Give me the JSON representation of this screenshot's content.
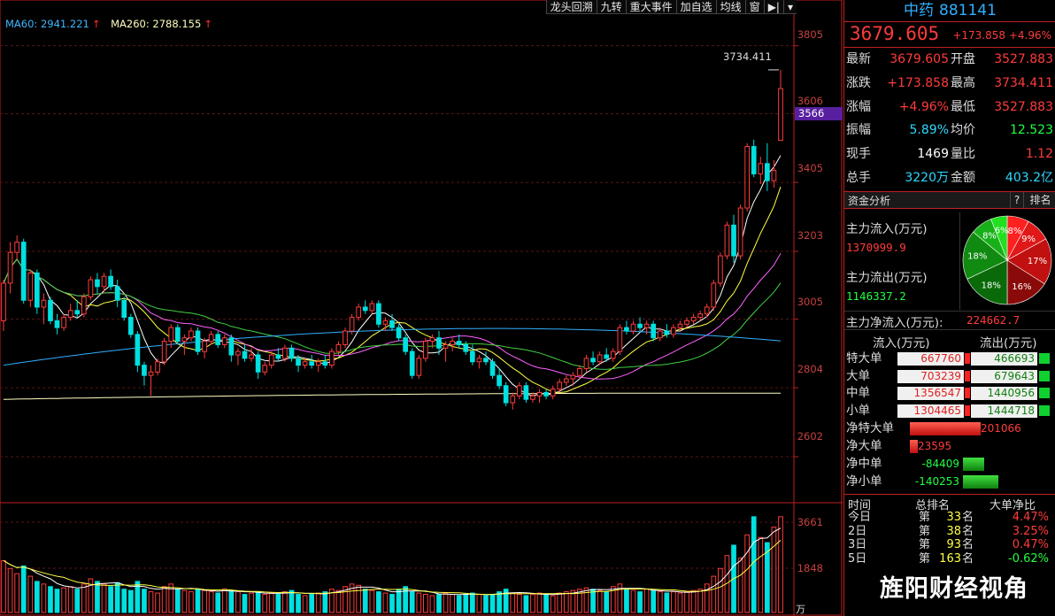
{
  "toolbar": {
    "buttons": [
      "龙头回溯",
      "九转",
      "重大事件",
      "加自选",
      "均线",
      "窗"
    ],
    "arrow_glyph": "▶|"
  },
  "ma_legend": {
    "ma60": "MA60: 2941.221",
    "ma260": "MA260: 2788.155",
    "up_arrow": "↑"
  },
  "price_axis": [
    "3805",
    "3606",
    "3405",
    "3203",
    "3005",
    "2804",
    "2602"
  ],
  "current_price_tag": "3566",
  "high_label": "3734.411",
  "volume_axis": [
    "3661",
    "1848"
  ],
  "volume_unit": "万",
  "colors": {
    "up": "#ff3b3b",
    "down": "#00e0e0",
    "ma5": "#ffffff",
    "ma10": "#ffff40",
    "ma20": "#ff60ff",
    "ma30": "#40d040",
    "ma60": "#30b0ff",
    "ma260": "#ffffc0",
    "panel_border": "#c02020"
  },
  "chart_data": {
    "type": "candlestick",
    "ylim": [
      2470,
      3900
    ],
    "candles": [
      [
        3000,
        3120,
        2970,
        3110
      ],
      [
        3110,
        3230,
        3080,
        3200
      ],
      [
        3200,
        3250,
        3180,
        3230
      ],
      [
        3230,
        3240,
        3050,
        3060
      ],
      [
        3060,
        3150,
        3040,
        3140
      ],
      [
        3140,
        3150,
        3020,
        3040
      ],
      [
        3040,
        3080,
        2990,
        3060
      ],
      [
        3060,
        3070,
        2990,
        3000
      ],
      [
        3000,
        3020,
        2960,
        2980
      ],
      [
        2980,
        3020,
        2970,
        3010
      ],
      [
        3010,
        3050,
        3000,
        3030
      ],
      [
        3030,
        3060,
        3010,
        3020
      ],
      [
        3020,
        3080,
        3010,
        3070
      ],
      [
        3070,
        3130,
        3060,
        3120
      ],
      [
        3120,
        3140,
        3080,
        3100
      ],
      [
        3100,
        3140,
        3080,
        3130
      ],
      [
        3130,
        3150,
        3090,
        3100
      ],
      [
        3100,
        3120,
        3040,
        3060
      ],
      [
        3060,
        3070,
        3000,
        3010
      ],
      [
        3010,
        3020,
        2950,
        2960
      ],
      [
        2960,
        2970,
        2850,
        2870
      ],
      [
        2870,
        2880,
        2810,
        2840
      ],
      [
        2840,
        2870,
        2780,
        2850
      ],
      [
        2850,
        2890,
        2840,
        2880
      ],
      [
        2880,
        2950,
        2870,
        2940
      ],
      [
        2940,
        2990,
        2920,
        2980
      ],
      [
        2980,
        2990,
        2930,
        2940
      ],
      [
        2940,
        2960,
        2900,
        2950
      ],
      [
        2950,
        2980,
        2940,
        2970
      ],
      [
        2970,
        2980,
        2900,
        2910
      ],
      [
        2910,
        2950,
        2890,
        2940
      ],
      [
        2940,
        2970,
        2930,
        2960
      ],
      [
        2960,
        2970,
        2920,
        2930
      ],
      [
        2930,
        2960,
        2920,
        2950
      ],
      [
        2950,
        2960,
        2880,
        2900
      ],
      [
        2900,
        2920,
        2870,
        2910
      ],
      [
        2910,
        2930,
        2880,
        2890
      ],
      [
        2890,
        2920,
        2880,
        2900
      ],
      [
        2900,
        2910,
        2830,
        2850
      ],
      [
        2850,
        2880,
        2840,
        2870
      ],
      [
        2870,
        2910,
        2860,
        2900
      ],
      [
        2900,
        2920,
        2880,
        2890
      ],
      [
        2890,
        2930,
        2880,
        2920
      ],
      [
        2920,
        2930,
        2880,
        2890
      ],
      [
        2890,
        2900,
        2850,
        2870
      ],
      [
        2870,
        2890,
        2860,
        2880
      ],
      [
        2880,
        2900,
        2860,
        2870
      ],
      [
        2870,
        2890,
        2850,
        2880
      ],
      [
        2880,
        2900,
        2860,
        2870
      ],
      [
        2870,
        2920,
        2860,
        2910
      ],
      [
        2910,
        2940,
        2900,
        2930
      ],
      [
        2930,
        2980,
        2920,
        2970
      ],
      [
        2970,
        3020,
        2960,
        3010
      ],
      [
        3010,
        3050,
        3000,
        3040
      ],
      [
        3040,
        3060,
        3020,
        3030
      ],
      [
        3030,
        3060,
        3020,
        3050
      ],
      [
        3050,
        3060,
        2980,
        2990
      ],
      [
        2990,
        3010,
        2970,
        3000
      ],
      [
        3000,
        3020,
        2970,
        2980
      ],
      [
        2980,
        2990,
        2940,
        2950
      ],
      [
        2950,
        2960,
        2900,
        2910
      ],
      [
        2910,
        2920,
        2830,
        2840
      ],
      [
        2840,
        2900,
        2830,
        2890
      ],
      [
        2890,
        2950,
        2880,
        2940
      ],
      [
        2940,
        2960,
        2920,
        2950
      ],
      [
        2950,
        2970,
        2900,
        2920
      ],
      [
        2920,
        2940,
        2880,
        2930
      ],
      [
        2930,
        2950,
        2910,
        2940
      ],
      [
        2940,
        2960,
        2920,
        2930
      ],
      [
        2930,
        2940,
        2900,
        2910
      ],
      [
        2910,
        2930,
        2870,
        2880
      ],
      [
        2880,
        2900,
        2860,
        2890
      ],
      [
        2890,
        2910,
        2870,
        2880
      ],
      [
        2880,
        2890,
        2830,
        2840
      ],
      [
        2840,
        2860,
        2800,
        2810
      ],
      [
        2810,
        2820,
        2750,
        2760
      ],
      [
        2760,
        2790,
        2740,
        2780
      ],
      [
        2780,
        2820,
        2770,
        2810
      ],
      [
        2810,
        2820,
        2760,
        2770
      ],
      [
        2770,
        2790,
        2760,
        2780
      ],
      [
        2780,
        2800,
        2760,
        2790
      ],
      [
        2790,
        2800,
        2770,
        2780
      ],
      [
        2780,
        2810,
        2770,
        2800
      ],
      [
        2800,
        2830,
        2790,
        2820
      ],
      [
        2820,
        2840,
        2810,
        2830
      ],
      [
        2830,
        2850,
        2810,
        2840
      ],
      [
        2840,
        2870,
        2830,
        2860
      ],
      [
        2860,
        2900,
        2850,
        2890
      ],
      [
        2890,
        2910,
        2870,
        2880
      ],
      [
        2880,
        2910,
        2870,
        2900
      ],
      [
        2900,
        2920,
        2880,
        2890
      ],
      [
        2890,
        2920,
        2880,
        2910
      ],
      [
        2910,
        2990,
        2900,
        2980
      ],
      [
        2980,
        3000,
        2960,
        2970
      ],
      [
        2970,
        3000,
        2960,
        2990
      ],
      [
        2990,
        3010,
        2970,
        2980
      ],
      [
        2980,
        3000,
        2960,
        2990
      ],
      [
        2990,
        3000,
        2940,
        2950
      ],
      [
        2950,
        2980,
        2940,
        2970
      ],
      [
        2970,
        2990,
        2950,
        2960
      ],
      [
        2960,
        2990,
        2950,
        2980
      ],
      [
        2980,
        3000,
        2970,
        2990
      ],
      [
        2990,
        3010,
        2980,
        3000
      ],
      [
        3000,
        3020,
        2990,
        3010
      ],
      [
        3010,
        3030,
        3000,
        3020
      ],
      [
        3020,
        3050,
        3010,
        3040
      ],
      [
        3040,
        3120,
        3030,
        3110
      ],
      [
        3110,
        3200,
        3100,
        3190
      ],
      [
        3190,
        3290,
        3180,
        3280
      ],
      [
        3280,
        3310,
        3170,
        3190
      ],
      [
        3190,
        3340,
        3180,
        3330
      ],
      [
        3330,
        3520,
        3320,
        3510
      ],
      [
        3510,
        3530,
        3420,
        3430
      ],
      [
        3430,
        3480,
        3400,
        3460
      ],
      [
        3460,
        3520,
        3380,
        3410
      ],
      [
        3410,
        3470,
        3390,
        3440
      ],
      [
        3527.883,
        3734.411,
        3527.883,
        3679.605
      ]
    ],
    "volumes": [
      2000,
      1700,
      1500,
      1800,
      1400,
      1200,
      1100,
      1000,
      900,
      950,
      1000,
      900,
      1100,
      1300,
      1200,
      1100,
      1000,
      1150,
      900,
      850,
      1200,
      900,
      800,
      750,
      1000,
      1100,
      900,
      850,
      800,
      900,
      850,
      800,
      750,
      900,
      850,
      800,
      700,
      750,
      800,
      700,
      750,
      700,
      800,
      850,
      700,
      650,
      700,
      750,
      800,
      900,
      850,
      1000,
      1100,
      1050,
      900,
      850,
      800,
      750,
      700,
      900,
      1000,
      800,
      750,
      700,
      650,
      700,
      750,
      700,
      650,
      700,
      750,
      700,
      650,
      700,
      800,
      900,
      750,
      700,
      650,
      700,
      750,
      700,
      650,
      750,
      800,
      850,
      900,
      950,
      900,
      850,
      800,
      1000,
      1100,
      900,
      850,
      800,
      900,
      850,
      800,
      750,
      800,
      750,
      800,
      850,
      900,
      1100,
      1400,
      1700,
      2200,
      2600,
      2100,
      3000,
      3700,
      2900,
      2700,
      3300,
      3700
    ]
  },
  "panel": {
    "name": "中药",
    "code": "881141",
    "price": "3679.605",
    "change": "+173.858 +4.96%",
    "rows": [
      {
        "l1": "最新",
        "v1": "3679.605",
        "c1": "red",
        "l2": "开盘",
        "v2": "3527.883",
        "c2": "red"
      },
      {
        "l1": "涨跌",
        "v1": "+173.858",
        "c1": "red",
        "l2": "最高",
        "v2": "3734.411",
        "c2": "red"
      },
      {
        "l1": "涨幅",
        "v1": "+4.96%",
        "c1": "red",
        "l2": "最低",
        "v2": "3527.883",
        "c2": "red"
      },
      {
        "l1": "振幅",
        "v1": "5.89%",
        "c1": "cyan",
        "l2": "均价",
        "v2": "12.523",
        "c2": "green"
      },
      {
        "l1": "现手",
        "v1": "1469",
        "c1": "white",
        "l2": "量比",
        "v2": "1.12",
        "c2": "red"
      },
      {
        "l1": "总手",
        "v1": "3220万",
        "c1": "cyan",
        "l2": "金额",
        "v2": "403.2亿",
        "c2": "cyan"
      }
    ],
    "section_title": "资金分析",
    "section_help": "?",
    "section_rank": "排名",
    "inflow_label": "主力流入(万元)",
    "inflow_value": "1370999.9",
    "outflow_label": "主力流出(万元)",
    "outflow_value": "1146337.2",
    "net_label": "主力净流入(万元):",
    "net_value": "224662.7",
    "pie": [
      {
        "label": "8%",
        "value": 8,
        "color": "#ff2020"
      },
      {
        "label": "9%",
        "value": 9,
        "color": "#e01818"
      },
      {
        "label": "17%",
        "value": 17,
        "color": "#c01010"
      },
      {
        "label": "16%",
        "value": 16,
        "color": "#8a0a0a"
      },
      {
        "label": "18%",
        "value": 18,
        "color": "#0a6a0a"
      },
      {
        "label": "18%",
        "value": 18,
        "color": "#108a10"
      },
      {
        "label": "8%",
        "value": 8,
        "color": "#18b018"
      },
      {
        "label": "6%",
        "value": 6,
        "color": "#20e020"
      }
    ],
    "flow_header_in": "流入(万元)",
    "flow_header_out": "流出(万元)",
    "flows": [
      {
        "label": "特大单",
        "in": "667760",
        "out": "466693"
      },
      {
        "label": "大单",
        "in": "703239",
        "out": "679643"
      },
      {
        "label": "中单",
        "in": "1356547",
        "out": "1440956"
      },
      {
        "label": "小单",
        "in": "1304465",
        "out": "1444718"
      }
    ],
    "nets": [
      {
        "label": "净特大单",
        "value": "201066",
        "num": 201066
      },
      {
        "label": "净大单",
        "value": "23595",
        "num": 23595
      },
      {
        "label": "净中单",
        "value": "-84409",
        "num": -84409
      },
      {
        "label": "净小单",
        "value": "-140253",
        "num": -140253
      }
    ],
    "rank_headers": [
      "时间",
      "总排名",
      "大单净比"
    ],
    "ranks": [
      {
        "day": "今日",
        "rank": "33",
        "pct": "4.47%",
        "color": "red"
      },
      {
        "day": "2日",
        "rank": "38",
        "pct": "3.25%",
        "color": "red"
      },
      {
        "day": "3日",
        "rank": "93",
        "pct": "0.47%",
        "color": "red"
      },
      {
        "day": "5日",
        "rank": "163",
        "pct": "-0.62%",
        "color": "green"
      }
    ],
    "rank_di": "第",
    "rank_ming": "名"
  },
  "watermark": "旌阳财经视角"
}
